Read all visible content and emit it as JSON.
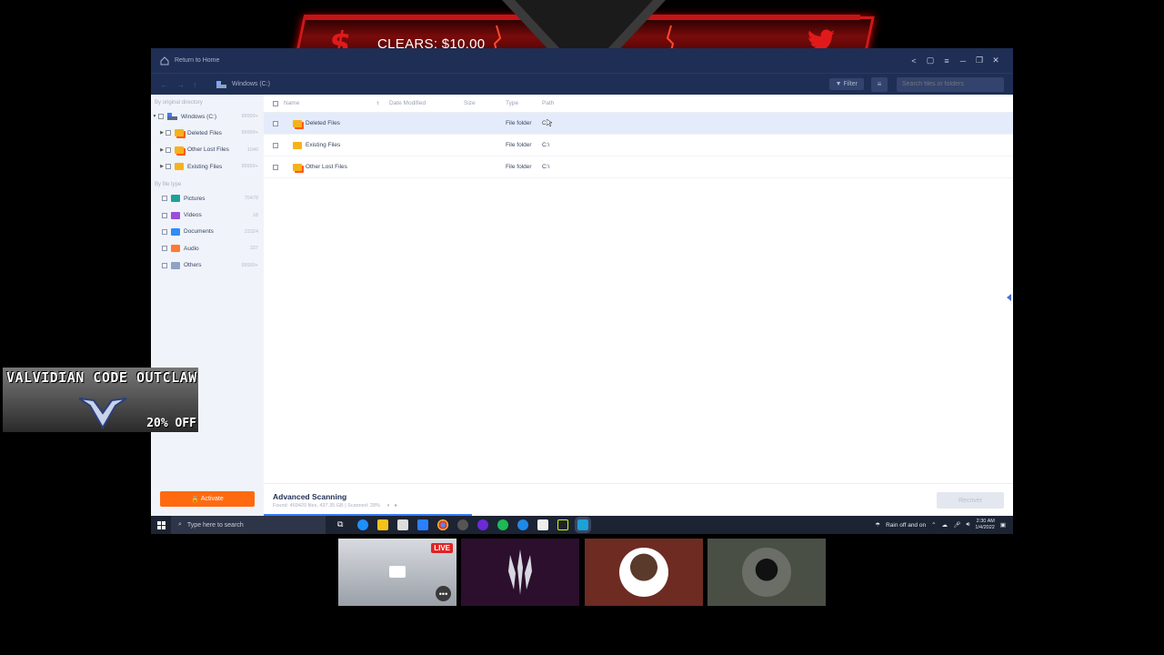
{
  "banner": {
    "text": "CLEARS: $10.00",
    "dollar": "$"
  },
  "window": {
    "title": "Return to Home",
    "breadcrumb": "Windows (C:)",
    "filter_label": "Filter",
    "search_placeholder": "Search files or folders"
  },
  "sidebar": {
    "section1": "By original directory",
    "root": {
      "label": "Windows (C:)",
      "count": "99999+"
    },
    "dirs": [
      {
        "label": "Deleted Files",
        "count": "99999+"
      },
      {
        "label": "Other Lost Files",
        "count": "1040"
      },
      {
        "label": "Existing Files",
        "count": "99999+"
      }
    ],
    "section2": "By file type",
    "types": [
      {
        "label": "Pictures",
        "count": "70478",
        "color": "#1aa39a"
      },
      {
        "label": "Videos",
        "count": "18",
        "color": "#9a4fd6"
      },
      {
        "label": "Documents",
        "count": "23324",
        "color": "#2f8cf0"
      },
      {
        "label": "Audio",
        "count": "337",
        "color": "#ff7a2e"
      },
      {
        "label": "Others",
        "count": "99999+",
        "color": "#8fa3c2"
      }
    ],
    "activate_label": "Activate"
  },
  "table": {
    "headers": {
      "name": "Name",
      "date": "Date Modified",
      "size": "Size",
      "type": "Type",
      "path": "Path"
    },
    "rows": [
      {
        "name": "Deleted Files",
        "type": "File folder",
        "path": "C:\\"
      },
      {
        "name": "Existing Files",
        "type": "File folder",
        "path": "C:\\"
      },
      {
        "name": "Other Lost Files",
        "type": "File folder",
        "path": "C:\\"
      }
    ]
  },
  "status": {
    "title": "Advanced Scanning",
    "info": "Found: 469420 files, 437.35 GB  |  Scanned: 28%",
    "progress": 0.28,
    "recover_label": "Recover"
  },
  "taskbar": {
    "search_placeholder": "Type here to search",
    "weather": "Rain off and on",
    "time": "2:30 AM",
    "date": "1/4/2022"
  },
  "promo": {
    "title": "VALVIDIAN CODE OUTCLAW",
    "discount": "20% OFF"
  },
  "tiles": {
    "live_label": "LIVE",
    "more": "•••"
  }
}
